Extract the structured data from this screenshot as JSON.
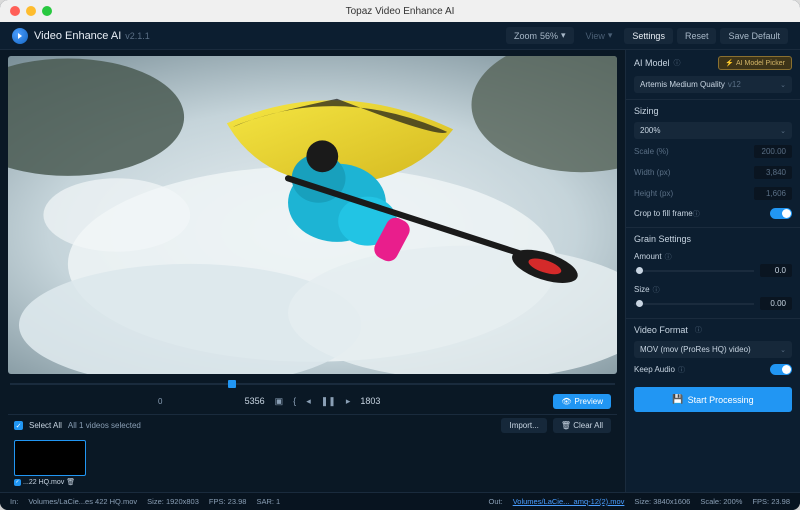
{
  "window_title": "Topaz Video Enhance AI",
  "header": {
    "app_name": "Video Enhance AI",
    "version": "v2.1.1",
    "zoom_label": "Zoom",
    "zoom_value": "56%",
    "view_label": "View",
    "settings_label": "Settings",
    "reset_label": "Reset",
    "save_default_label": "Save Default"
  },
  "playbar": {
    "time_left": "0",
    "frame_current": "5356",
    "frame_other": "1803"
  },
  "preview_button": "Preview",
  "selection": {
    "select_all": "Select All",
    "count_text": "All 1 videos selected",
    "import": "Import...",
    "clear_all": "Clear All"
  },
  "thumb": {
    "filename": "...22 HQ.mov"
  },
  "sidebar": {
    "ai_model": {
      "header": "AI Model",
      "picker": "AI Model Picker",
      "selected": "Artemis Medium Quality",
      "selected_ver": "v12"
    },
    "sizing": {
      "header": "Sizing",
      "preset": "200%",
      "scale_label": "Scale (%)",
      "scale_val": "200.00",
      "width_label": "Width (px)",
      "width_val": "3,840",
      "height_label": "Height (px)",
      "height_val": "1,606",
      "crop_label": "Crop to fill frame"
    },
    "grain": {
      "header": "Grain Settings",
      "amount_label": "Amount",
      "amount_val": "0.0",
      "size_label": "Size",
      "size_val": "0.00"
    },
    "format": {
      "header": "Video Format",
      "selected": "MOV (mov (ProRes HQ) video)",
      "keep_audio_label": "Keep Audio"
    },
    "start": "Start Processing"
  },
  "footer": {
    "in_label": "In:",
    "in_path": "Volumes/LaCie...es 422 HQ.mov",
    "in_size_label": "Size:",
    "in_size": "1920x803",
    "in_fps_label": "FPS:",
    "in_fps": "23.98",
    "sar_label": "SAR:",
    "sar": "1",
    "out_label": "Out:",
    "out_path": "Volumes/LaCie..._amq-12(2).mov",
    "out_size_label": "Size:",
    "out_size": "3840x1606",
    "scale_label": "Scale:",
    "scale": "200%",
    "out_fps_label": "FPS:",
    "out_fps": "23.98"
  }
}
